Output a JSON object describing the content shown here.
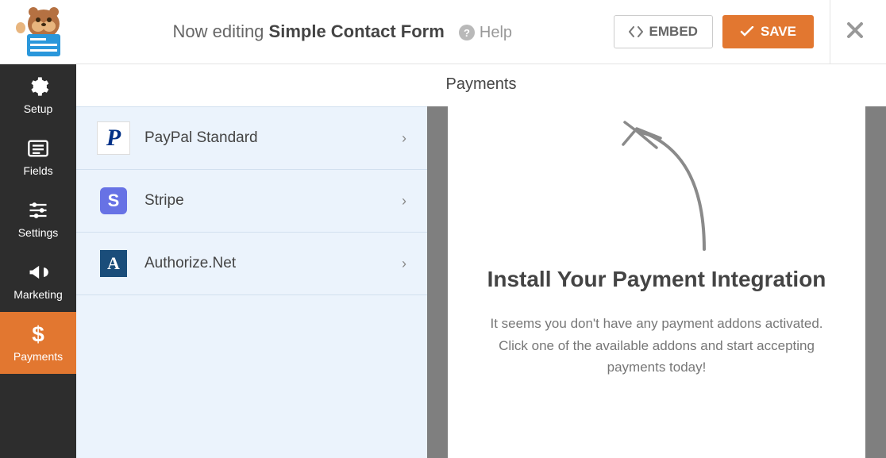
{
  "topbar": {
    "editing_prefix": "Now editing ",
    "form_name": "Simple Contact Form",
    "help_label": "Help",
    "embed_label": "EMBED",
    "save_label": "SAVE"
  },
  "sidebar": {
    "items": [
      {
        "label": "Setup"
      },
      {
        "label": "Fields"
      },
      {
        "label": "Settings"
      },
      {
        "label": "Marketing"
      },
      {
        "label": "Payments"
      }
    ]
  },
  "panel": {
    "title": "Payments",
    "options": [
      {
        "label": "PayPal Standard"
      },
      {
        "label": "Stripe"
      },
      {
        "label": "Authorize.Net"
      }
    ],
    "card": {
      "title": "Install Your Payment Integration",
      "description": "It seems you don't have any payment addons activated. Click one of the available addons and start accepting payments today!"
    }
  }
}
